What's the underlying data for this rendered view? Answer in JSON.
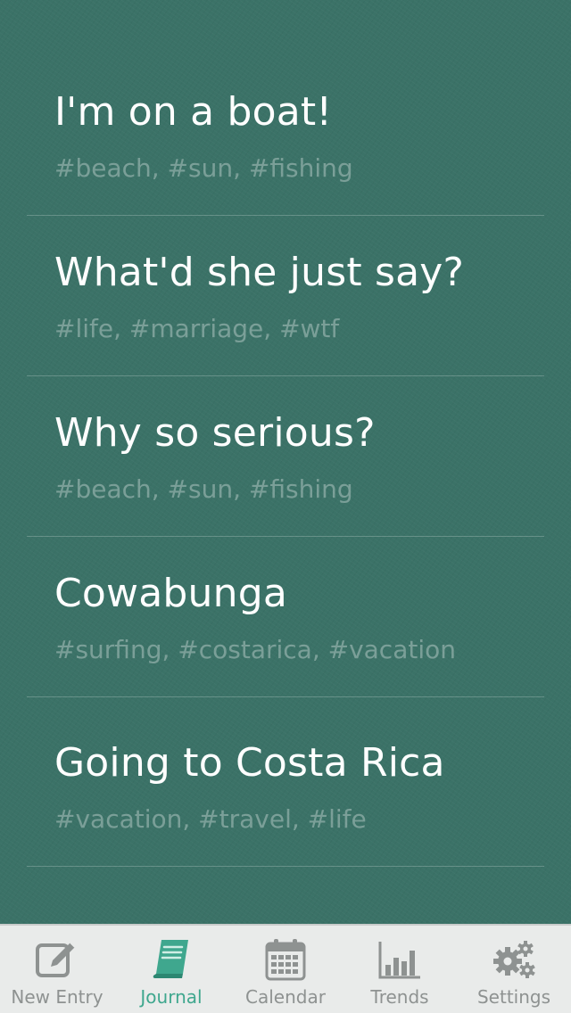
{
  "entries": [
    {
      "title": "I'm on a boat!",
      "tags": "#beach, #sun, #fishing"
    },
    {
      "title": "What'd she just say?",
      "tags": "#life, #marriage, #wtf"
    },
    {
      "title": "Why so serious?",
      "tags": "#beach, #sun, #fishing"
    },
    {
      "title": "Cowabunga",
      "tags": "#surfing, #costarica, #vacation"
    },
    {
      "title": "Going to Costa Rica",
      "tags": "#vacation, #travel, #life"
    }
  ],
  "tabbar": {
    "active": "journal",
    "items": [
      {
        "id": "new-entry",
        "label": "New Entry",
        "icon": "compose-icon"
      },
      {
        "id": "journal",
        "label": "Journal",
        "icon": "book-icon"
      },
      {
        "id": "calendar",
        "label": "Calendar",
        "icon": "calendar-icon"
      },
      {
        "id": "trends",
        "label": "Trends",
        "icon": "bar-chart-icon"
      },
      {
        "id": "settings",
        "label": "Settings",
        "icon": "gears-icon"
      }
    ]
  },
  "colors": {
    "background": "#3b7267",
    "accent": "#3fa78e",
    "tab_inactive": "#8e9291",
    "tabbar_background": "#e9ebea"
  }
}
